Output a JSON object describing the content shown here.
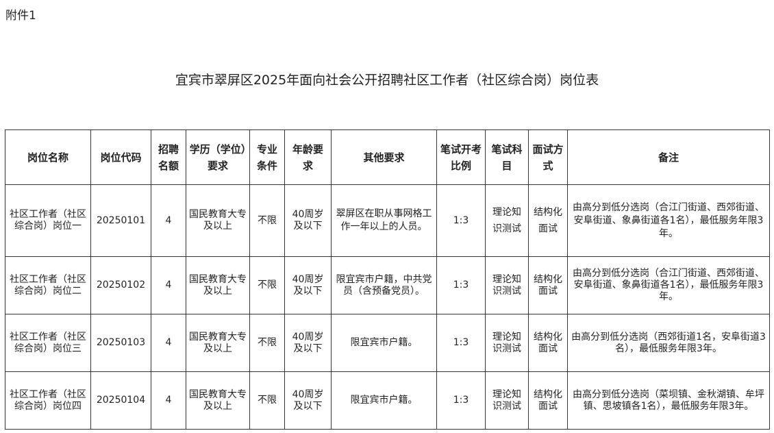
{
  "header": {
    "attachment_label": "附件1",
    "title": "宜宾市翠屏区2025年面向社会公开招聘社区工作者（社区综合岗）岗位表"
  },
  "table": {
    "columns": [
      "岗位名称",
      "岗位代码",
      "招聘名额",
      "学历（学位）要求",
      "专业条件",
      "年龄要求",
      "其他要求",
      "笔试开考比例",
      "笔试科目",
      "面试方式",
      "备注"
    ],
    "rows": [
      {
        "name": "社区工作者（社区综合岗）岗位一",
        "code": "20250101",
        "quota": "4",
        "education": "国民教育大专及以上",
        "major": "不限",
        "age": "40周岁及以下",
        "other": "翠屏区在职从事网格工作一年以上的人员。",
        "ratio": "1:3",
        "subject": "理论知识测试",
        "interview": "结构化面试",
        "note": "由高分到低分选岗（合江门街道、西郊街道、安阜街道、象鼻街道各1名），最低服务年限3年。"
      },
      {
        "name": "社区工作者（社区综合岗）岗位二",
        "code": "20250102",
        "quota": "4",
        "education": "国民教育大专及以上",
        "major": "不限",
        "age": "40周岁及以下",
        "other": "限宜宾市户籍，中共党员（含预备党员）。",
        "ratio": "1:3",
        "subject": "理论知识测试",
        "interview": "结构化面试",
        "note": "由高分到低分选岗（合江门街道、西郊街道、安阜街道、象鼻街道各1名），最低服务年限3年。"
      },
      {
        "name": "社区工作者（社区综合岗）岗位三",
        "code": "20250103",
        "quota": "4",
        "education": "国民教育大专及以上",
        "major": "不限",
        "age": "40周岁及以下",
        "other": "限宜宾市户籍。",
        "ratio": "1:3",
        "subject": "理论知识测试",
        "interview": "结构化面试",
        "note": "由高分到低分选岗（西郊街道1名，安阜街道3名），最低服务年限3年。"
      },
      {
        "name": "社区工作者（社区综合岗）岗位四",
        "code": "20250104",
        "quota": "4",
        "education": "国民教育大专及以上",
        "major": "不限",
        "age": "40周岁及以下",
        "other": "限宜宾市户籍。",
        "ratio": "1:3",
        "subject": "理论知识测试",
        "interview": "结构化面试",
        "note": "由高分到低分选岗（菜坝镇、金秋湖镇、牟坪镇、思坡镇各1名），最低服务年限3年。"
      }
    ]
  }
}
